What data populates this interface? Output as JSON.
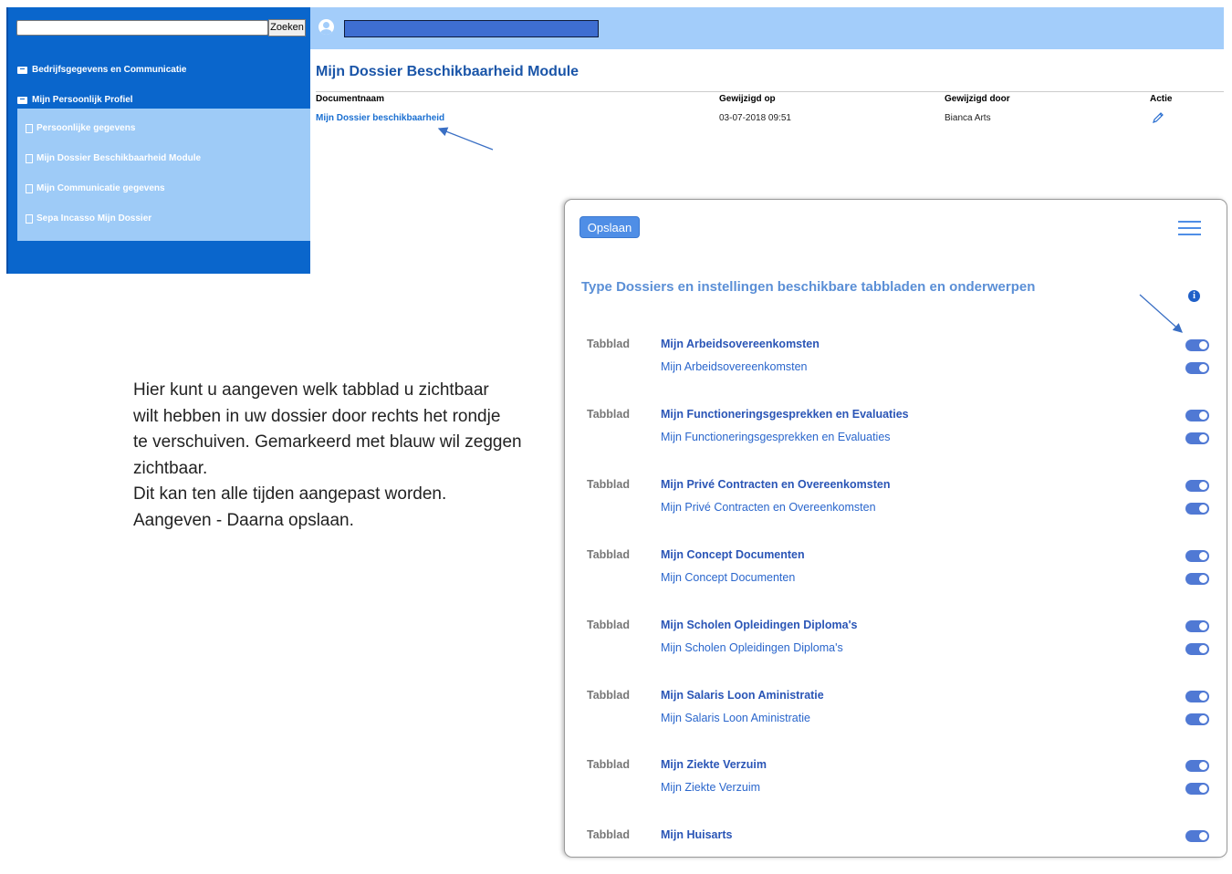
{
  "sidebar": {
    "search_button": "Zoeken",
    "nav_sections": [
      {
        "label": "Bedrijfsgegevens en Communicatie"
      },
      {
        "label": "Mijn Persoonlijk Profiel"
      }
    ],
    "sub_items": [
      {
        "label": "Persoonlijke gegevens"
      },
      {
        "label": "Mijn Dossier Beschikbaarheid Module"
      },
      {
        "label": "Mijn Communicatie gegevens"
      },
      {
        "label": "Sepa Incasso Mijn Dossier"
      }
    ]
  },
  "header": {
    "page_title": "Mijn Dossier Beschikbaarheid Module"
  },
  "document_table": {
    "columns": [
      "Documentnaam",
      "Gewijzigd op",
      "Gewijzigd door",
      "Actie"
    ],
    "rows": [
      {
        "name": "Mijn Dossier beschikbaarheid",
        "modified_on": "03-07-2018 09:51",
        "modified_by": "Bianca Arts",
        "action_icon": "pencil-icon"
      }
    ]
  },
  "instructions": {
    "lines": [
      "Hier kunt u aangeven welk tabblad u zichtbaar",
      "wilt hebben in uw dossier door rechts het rondje",
      "te verschuiven. Gemarkeerd met blauw wil zeggen",
      "zichtbaar.",
      "Dit kan ten alle tijden aangepast worden.",
      "Aangeven - Daarna opslaan."
    ]
  },
  "settings_panel": {
    "save_label": "Opslaan",
    "menu_icon": "hamburger-menu-icon",
    "title": "Type Dossiers en instellingen beschikbare tabbladen en onderwerpen",
    "info_icon": "info-icon",
    "toggle_color": "#5079d4",
    "tabs": [
      {
        "type_label": "Tabblad",
        "title": "Mijn Arbeidsovereenkomsten",
        "subtitle": "Mijn Arbeidsovereenkomsten",
        "enabled": true
      },
      {
        "type_label": "Tabblad",
        "title": "Mijn Functioneringsgesprekken en Evaluaties",
        "subtitle": "Mijn Functioneringsgesprekken en Evaluaties",
        "enabled": true
      },
      {
        "type_label": "Tabblad",
        "title": "Mijn Privé Contracten en Overeenkomsten",
        "subtitle": "Mijn Privé Contracten en Overeenkomsten",
        "enabled": true
      },
      {
        "type_label": "Tabblad",
        "title": "Mijn Concept Documenten",
        "subtitle": "Mijn Concept Documenten",
        "enabled": true
      },
      {
        "type_label": "Tabblad",
        "title": "Mijn Scholen Opleidingen Diploma's",
        "subtitle": "Mijn Scholen Opleidingen Diploma's",
        "enabled": true
      },
      {
        "type_label": "Tabblad",
        "title": "Mijn Salaris Loon Aministratie",
        "subtitle": "Mijn Salaris Loon Aministratie",
        "enabled": true
      },
      {
        "type_label": "Tabblad",
        "title": "Mijn Ziekte Verzuim",
        "subtitle": "Mijn Ziekte Verzuim",
        "enabled": true
      },
      {
        "type_label": "Tabblad",
        "title": "Mijn Huisarts",
        "subtitle": "",
        "enabled": true
      }
    ]
  }
}
